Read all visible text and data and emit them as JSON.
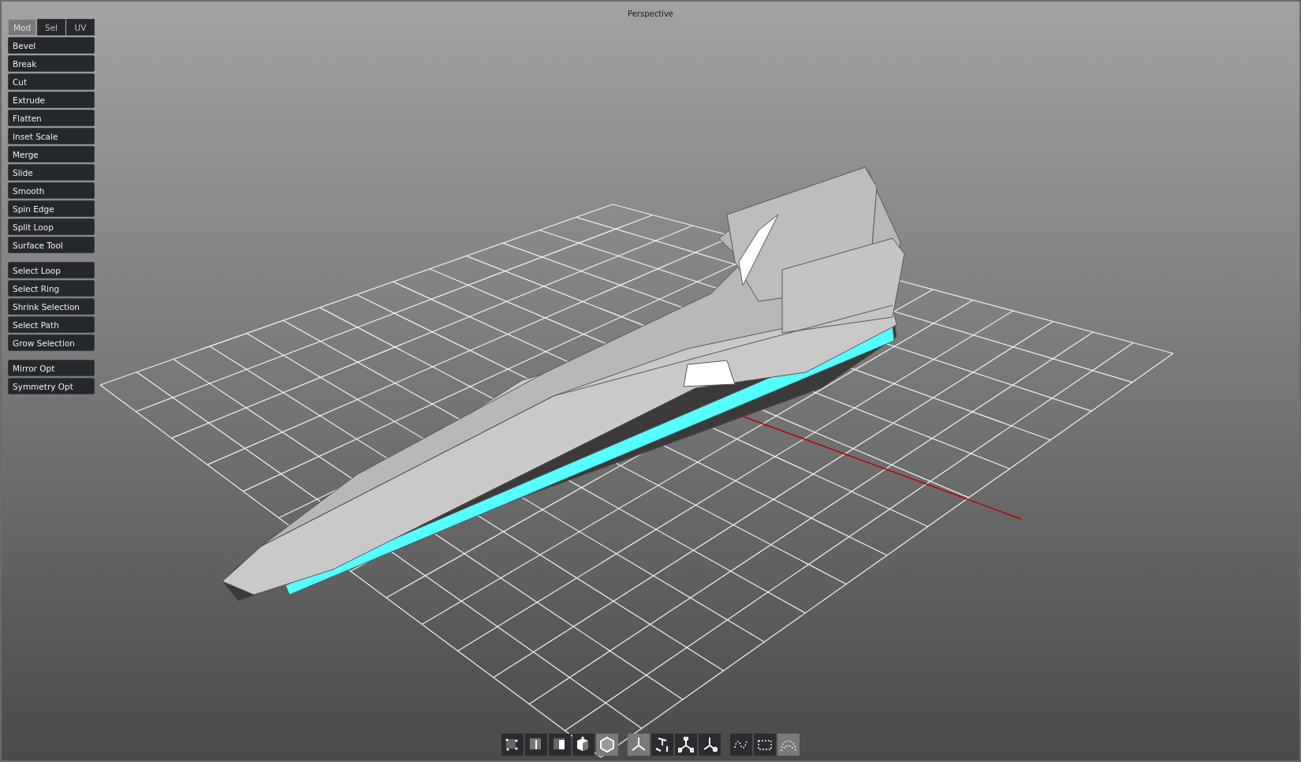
{
  "viewport": {
    "title": "Perspective"
  },
  "panel": {
    "tabs": [
      {
        "label": "Mod",
        "selected": true
      },
      {
        "label": "Sel",
        "selected": false
      },
      {
        "label": "UV",
        "selected": false
      }
    ],
    "groups": [
      [
        "Bevel",
        "Break",
        "Cut",
        "Extrude",
        "Flatten",
        "Inset Scale",
        "Merge",
        "Slide",
        "Smooth",
        "Spin Edge",
        "Split Loop",
        "Surface Tool"
      ],
      [
        "Select Loop",
        "Select Ring",
        "Shrink Selection",
        "Select Path",
        "Grow Selection"
      ],
      [
        "Mirror Opt",
        "Symmetry Opt"
      ]
    ]
  },
  "toolbar": [
    [
      {
        "kind": "vertex",
        "selected": false
      },
      {
        "kind": "edge",
        "selected": false
      },
      {
        "kind": "face",
        "selected": false
      },
      {
        "kind": "object",
        "selected": false
      },
      {
        "kind": "hex",
        "selected": true
      }
    ],
    [
      {
        "kind": "move",
        "selected": true
      },
      {
        "kind": "rotate",
        "selected": false
      },
      {
        "kind": "scale",
        "selected": false
      },
      {
        "kind": "universal",
        "selected": false
      }
    ],
    [
      {
        "kind": "lasso",
        "selected": false
      },
      {
        "kind": "box",
        "selected": false
      },
      {
        "kind": "paint",
        "selected": true
      }
    ]
  ]
}
